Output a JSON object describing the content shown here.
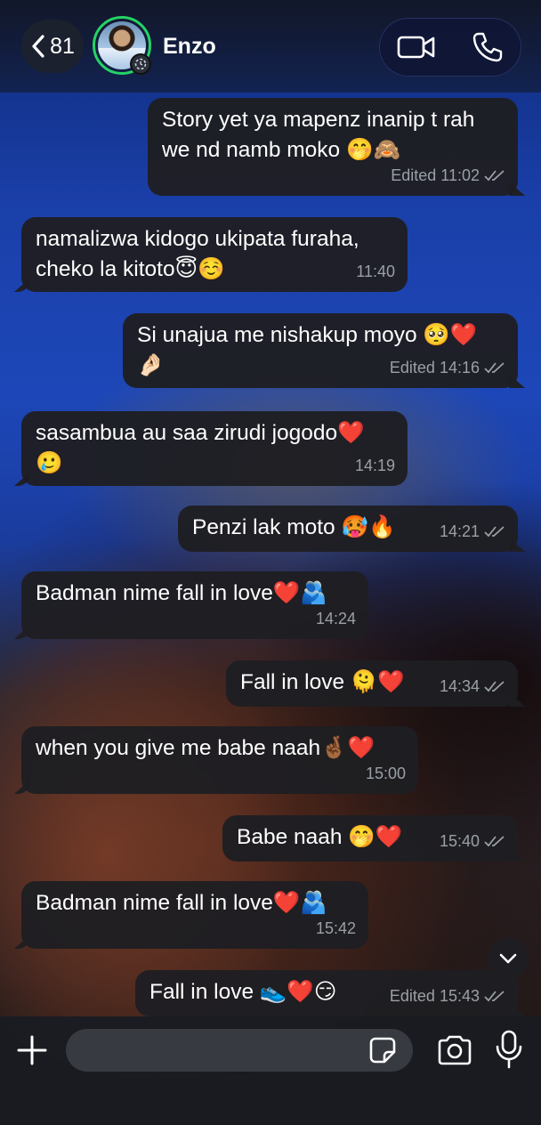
{
  "header": {
    "back_count": "81",
    "contact_name": "Enzo",
    "icons": [
      "chevron-left-icon",
      "status-ring",
      "video-call-icon",
      "phone-icon"
    ],
    "accent": "#25d366"
  },
  "messages": [
    {
      "dir": "out",
      "lines": [
        "Story yet ya mapenz inanip t rah",
        "we nd namb moko 🤭🙈"
      ],
      "meta": "Edited 11:02",
      "ticks": true
    },
    {
      "dir": "in",
      "lines": [
        "namalizwa kidogo ukipata furaha,",
        "cheko la kitoto😇☺️"
      ],
      "meta": "11:40"
    },
    {
      "dir": "out",
      "lines": [
        "Si unajua me nishakup moyo 🥺❤️",
        "🤌🏻"
      ],
      "meta": "Edited 14:16",
      "ticks": true
    },
    {
      "dir": "in",
      "lines": [
        "sasambua au saa zirudi jogodo❤️",
        "🥲"
      ],
      "meta": "14:19"
    },
    {
      "dir": "out",
      "lines": [
        "Penzi lak moto 🥵🔥"
      ],
      "meta": "14:21",
      "ticks": true
    },
    {
      "dir": "in",
      "lines": [
        "Badman nime fall in love❤️🫂"
      ],
      "meta": "14:24"
    },
    {
      "dir": "out",
      "lines": [
        "Fall in love 🫠❤️"
      ],
      "meta": "14:34",
      "ticks": true
    },
    {
      "dir": "in",
      "lines": [
        "when you give me babe naah🤞🏾❤️"
      ],
      "meta": "15:00"
    },
    {
      "dir": "out",
      "lines": [
        "Babe naah 🤭❤️"
      ],
      "meta": "15:40",
      "ticks": true
    },
    {
      "dir": "in",
      "lines": [
        "Badman nime fall in love❤️🫂"
      ],
      "meta": "15:42"
    },
    {
      "dir": "out",
      "lines": [
        "Fall in love 👟❤️😏"
      ],
      "meta": "Edited 15:43",
      "ticks": true
    }
  ],
  "composer": {
    "placeholder": "",
    "icons": [
      "plus-icon",
      "sticker-icon",
      "camera-icon",
      "microphone-icon",
      "chevron-down-icon"
    ]
  },
  "colors": {
    "bubble": "#1e1e22",
    "meta": "#9aa0a6",
    "ticks": "#9aa0a6"
  }
}
